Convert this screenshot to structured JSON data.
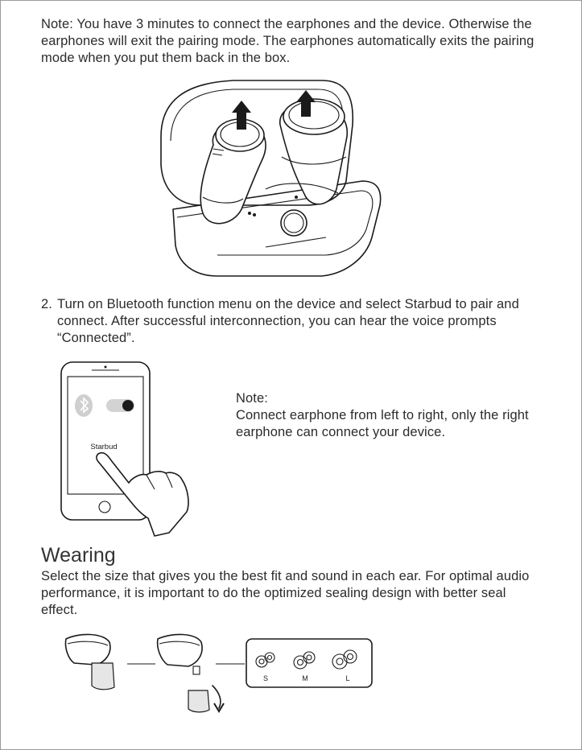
{
  "note_top": "Note: You have 3 minutes to connect the earphones  and the device. Otherwise the earphones will exit the pairing mode. The earphones automatically exits the pairing mode when you put them back in the box.",
  "step2": {
    "number": "2.",
    "text": "Turn on Bluetooth function menu on the device and select Starbud to pair and connect. After successful interconnection, you can hear the voice prompts “Connected”."
  },
  "phone": {
    "device_label": "Starbud"
  },
  "side_note": {
    "label": "Note:",
    "text": "Connect earphone from left to right, only the right earphone can connect your device."
  },
  "wearing": {
    "heading": "Wearing",
    "text": "Select the size that gives you the best fit and sound in each ear. For optimal audio performance, it is important to do  the optimized sealing design with better seal effect.",
    "tip_sizes": [
      "S",
      "M",
      "L"
    ]
  }
}
